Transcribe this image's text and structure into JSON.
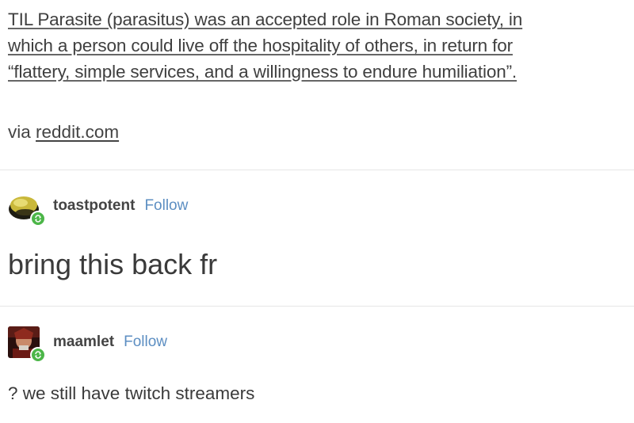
{
  "post": {
    "lines": [
      "TIL Parasite (parasitus) was an accepted role in Roman society, in",
      "which a person could live off the hospitality of others, in return for",
      "“flattery, simple services, and a willingness to endure humiliation”."
    ],
    "source_prefix": "via",
    "source_link": "reddit.com"
  },
  "reblogs": [
    {
      "username": "toastpotent",
      "follow_label": "Follow",
      "text": "bring this back fr",
      "avatar_icon": "toast-avatar-icon",
      "badge_icon": "reblog-icon"
    },
    {
      "username": "maamlet",
      "follow_label": "Follow",
      "text": "? we still have twitch streamers",
      "avatar_icon": "character-avatar-icon",
      "badge_icon": "reblog-icon"
    }
  ],
  "colors": {
    "follow": "#5c8ec2",
    "badge": "#4cb648",
    "divider": "#e6e6e6",
    "text": "#444444"
  }
}
